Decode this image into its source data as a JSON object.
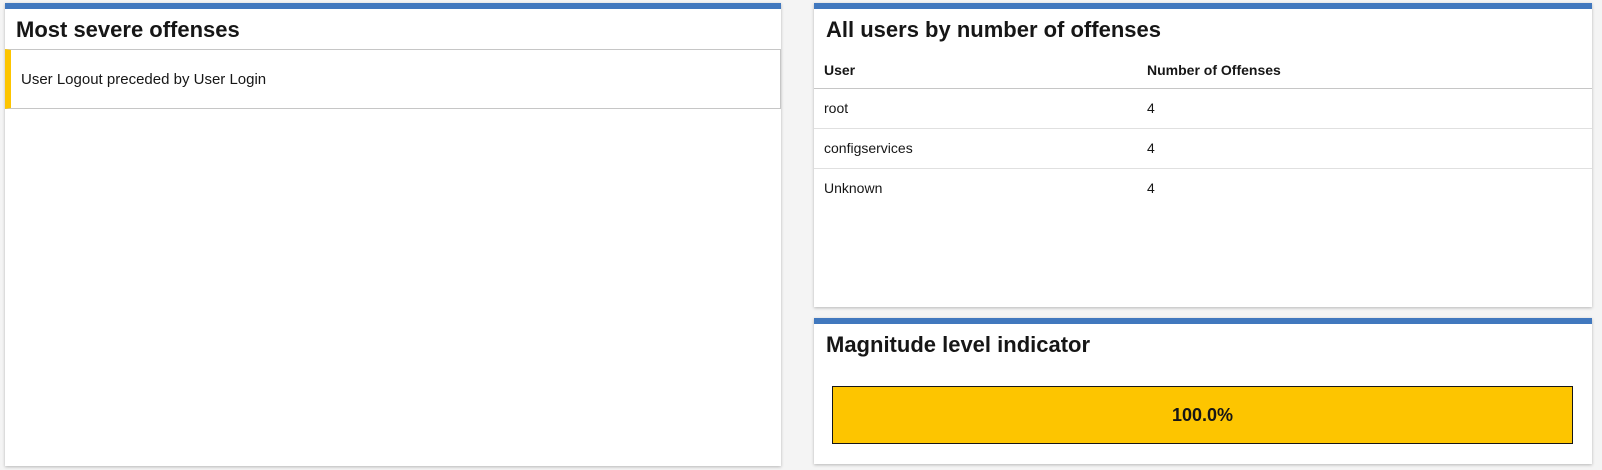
{
  "offenses_card": {
    "title": "Most severe offenses",
    "items": [
      {
        "label": "User Logout preceded by User Login",
        "severity_color": "#fdc500"
      }
    ]
  },
  "users_card": {
    "title": "All users by number of offenses",
    "columns": [
      "User",
      "Number of Offenses"
    ],
    "rows": [
      {
        "user": "root",
        "count": "4"
      },
      {
        "user": "configservices",
        "count": "4"
      },
      {
        "user": "Unknown",
        "count": "4"
      }
    ]
  },
  "magnitude_card": {
    "title": "Magnitude level indicator",
    "label": "100.0%",
    "value_percent": 100.0,
    "fill_color": "#fdc500"
  },
  "colors": {
    "accent": "#4178be",
    "severity": "#fdc500"
  }
}
